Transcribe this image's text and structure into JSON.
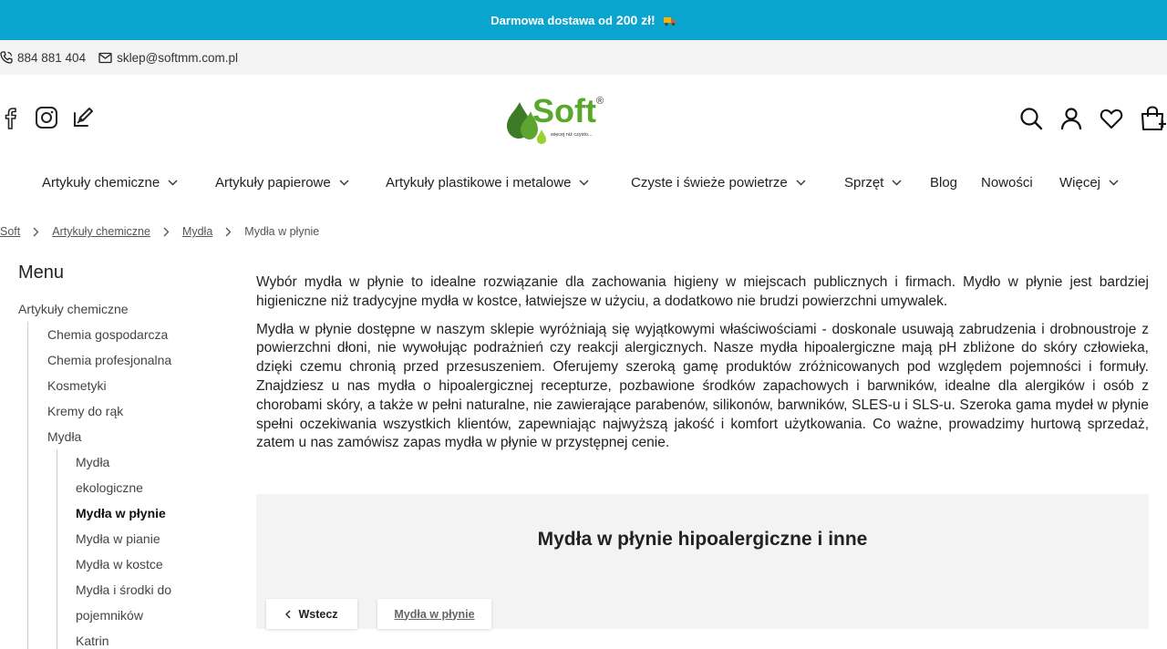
{
  "promo": {
    "text_before": "Darmowa dostawa od",
    "amount": "200 zł!",
    "truck_icon": "delivery-truck-icon",
    "bg": "#0aa5cf"
  },
  "contact": {
    "phone": "884 881 404",
    "email": "sklep@softmm.com.pl"
  },
  "logo": {
    "brand": "Soft",
    "registered": "®",
    "tagline": "więcej niż czysto..."
  },
  "nav": {
    "items": [
      {
        "label": "Artykuły chemiczne",
        "has_dropdown": true
      },
      {
        "label": "Artykuły papierowe",
        "has_dropdown": true
      },
      {
        "label": "Artykuły plastikowe i metalowe",
        "has_dropdown": true
      },
      {
        "label": "Czyste i świeże powietrze",
        "has_dropdown": true
      },
      {
        "label": "Sprzęt",
        "has_dropdown": true
      },
      {
        "label": "Blog",
        "has_dropdown": false
      },
      {
        "label": "Nowości",
        "has_dropdown": false
      },
      {
        "label": "Więcej",
        "has_dropdown": true
      }
    ]
  },
  "breadcrumb": [
    "Soft",
    "Artykuły chemiczne",
    "Mydła",
    "Mydła w płynie"
  ],
  "sidebar": {
    "title": "Menu",
    "root": "Artykuły chemiczne",
    "level1": [
      "Chemia gospodarcza",
      "Chemia profesjonalna",
      "Kosmetyki",
      "Kremy do rąk",
      "Mydła"
    ],
    "level2": [
      "Mydła",
      "ekologiczne",
      "Mydła w płynie",
      "Mydła w pianie",
      "Mydła w kostce",
      "Mydła i środki do",
      "pojemników",
      "Katrin"
    ],
    "active": "Mydła w płynie"
  },
  "content": {
    "p1": "Wybór mydła w płynie to idealne rozwiązanie dla zachowania higieny w miejscach publicznych i firmach. Mydło w płynie jest bardziej higieniczne niż tradycyjne mydła w kostce, łatwiejsze w użyciu, a dodatkowo nie brudzi powierzchni umywalek.",
    "p2": "Mydła w płynie dostępne w naszym sklepie wyróżniają się wyjątkowymi właściwościami - doskonale usuwają zabrudzenia i drobnoustroje z powierzchni dłoni, nie wywołując podrażnień czy reakcji alergicznych. Nasze mydła hipoalergiczne mają pH zbliżone do skóry człowieka, dzięki czemu chronią przed przesuszeniem. Oferujemy szeroką gamę produktów zróżnicowanych pod względem pojemności i formuły. Znajdziesz u nas mydła o hipoalergicznej recepturze, pozbawione środków zapachowych i barwników, idealne dla alergików i osób z chorobami skóry, a także w pełni naturalne, nie zawierające parabenów, silikonów, barwników, SLES-u i SLS-u. Szeroka gama mydeł w płynie spełni oczekiwania wszystkich klientów, zapewniając najwyższą jakość i komfort użytkowania. Co ważne, prowadzimy hurtową sprzedaż, zatem u nas zamówisz zapas mydła w płynie w przystępnej cenie."
  },
  "section": {
    "heading": "Mydła w płynie hipoalergiczne i inne",
    "back_label": "Wstecz",
    "current_label": "Mydła w płynie"
  },
  "colors": {
    "accent": "#0aa5cf",
    "logo_green": "#3f9a2a",
    "logo_light": "#9bd12f"
  }
}
